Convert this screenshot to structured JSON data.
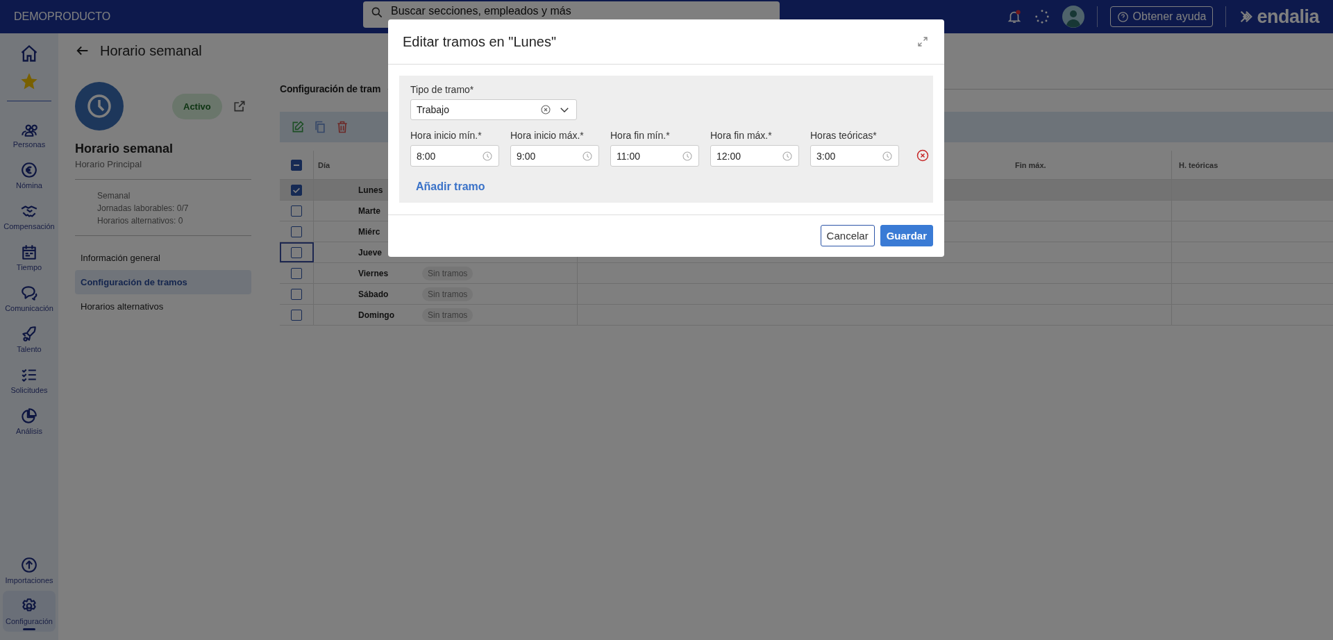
{
  "topbar": {
    "brand": "DEMOPRODUCTO",
    "search": {
      "placeholder": "Buscar secciones, empleados y más"
    },
    "help_button": "Obtener ayuda",
    "logo": "endalia"
  },
  "nav": {
    "items": [
      {
        "label": "Personas"
      },
      {
        "label": "Nómina"
      },
      {
        "label": "Compensación"
      },
      {
        "label": "Tiempo"
      },
      {
        "label": "Comunicación"
      },
      {
        "label": "Talento"
      },
      {
        "label": "Solicitudes"
      },
      {
        "label": "Análisis"
      }
    ],
    "bottom": [
      {
        "label": "Importaciones",
        "selected": false
      },
      {
        "label": "Configuración",
        "selected": true
      }
    ]
  },
  "panel": {
    "title": "Horario semanal",
    "status": "Activo",
    "name": "Horario semanal",
    "subtitle": "Horario Principal",
    "details": [
      "Semanal",
      "Jornadas laborables: 0/7",
      "Horarios alternativos: 0"
    ],
    "menu": [
      {
        "label": "Información general",
        "selected": false
      },
      {
        "label": "Configuración de tramos",
        "selected": true
      },
      {
        "label": "Horarios alternativos",
        "selected": false
      }
    ]
  },
  "section": {
    "title": "Configuración de tram"
  },
  "table": {
    "all_indeterminate": true,
    "columns": [
      "Día",
      "Fin máx.",
      "H. teóricas"
    ],
    "rows": [
      {
        "day": "Lunes",
        "checked": true,
        "focused": false
      },
      {
        "day": "Marte",
        "checked": false,
        "focused": false
      },
      {
        "day": "Miérc",
        "checked": false,
        "focused": false
      },
      {
        "day": "Jueve",
        "checked": false,
        "focused": true
      },
      {
        "day": "Viernes",
        "checked": false,
        "focused": false,
        "tag": "Sin tramos"
      },
      {
        "day": "Sábado",
        "checked": false,
        "focused": false,
        "tag": "Sin tramos"
      },
      {
        "day": "Domingo",
        "checked": false,
        "focused": false,
        "tag": "Sin tramos"
      }
    ]
  },
  "modal": {
    "title": "Editar tramos en \"Lunes\"",
    "type_field": {
      "label": "Tipo de tramo*",
      "value": "Trabajo"
    },
    "time_fields": [
      {
        "label": "Hora inicio mín.*",
        "value": "8:00"
      },
      {
        "label": "Hora inicio máx.*",
        "value": "9:00"
      },
      {
        "label": "Hora fin mín.*",
        "value": "11:00"
      },
      {
        "label": "Hora fin máx.*",
        "value": "12:00"
      },
      {
        "label": "Horas teóricas*",
        "value": "3:00"
      }
    ],
    "add_link": "Añadir tramo",
    "cancel_button": "Cancelar",
    "save_button": "Guardar"
  }
}
